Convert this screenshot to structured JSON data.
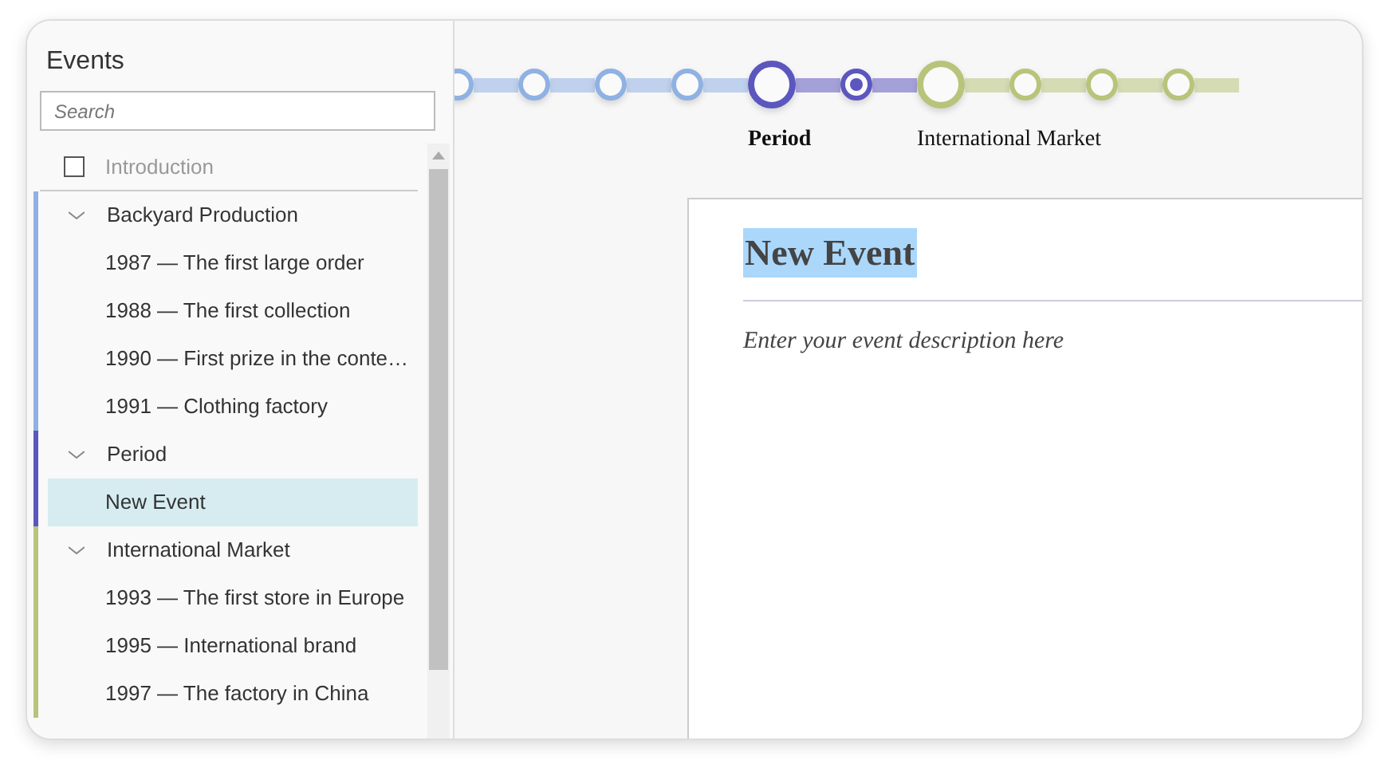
{
  "sidebar": {
    "title": "Events",
    "search": {
      "placeholder": "Search"
    },
    "intro": {
      "label": "Introduction",
      "checked": false
    },
    "groups": [
      {
        "label": "Backyard Production",
        "color": "#8fb1e3",
        "expanded": true,
        "items": [
          {
            "label": "1987 — The first large order",
            "selected": false
          },
          {
            "label": "1988 — The first collection",
            "selected": false
          },
          {
            "label": "1990 — First prize in the conte…",
            "selected": false
          },
          {
            "label": "1991 — Clothing factory",
            "selected": false
          }
        ]
      },
      {
        "label": "Period",
        "color": "#5b57bf",
        "expanded": true,
        "items": [
          {
            "label": "New Event",
            "selected": true
          }
        ]
      },
      {
        "label": "International Market",
        "color": "#b8c47a",
        "expanded": true,
        "items": [
          {
            "label": "1993 — The first store in Europe",
            "selected": false
          },
          {
            "label": "1995 — International brand",
            "selected": false
          },
          {
            "label": "1997 — The factory in China",
            "selected": false
          }
        ]
      }
    ]
  },
  "timeline": [
    {
      "color": "#8fb1e3",
      "nodes": [
        {
          "kind": "minor",
          "selected": false
        },
        {
          "kind": "minor",
          "selected": false
        },
        {
          "kind": "minor",
          "selected": false
        },
        {
          "kind": "minor",
          "selected": false
        }
      ]
    },
    {
      "label": "Period",
      "color": "#5b57bf",
      "nodes": [
        {
          "kind": "major",
          "selected": false
        },
        {
          "kind": "minor",
          "selected": true
        }
      ]
    },
    {
      "label": "International Market",
      "color": "#b8c47a",
      "nodes": [
        {
          "kind": "major",
          "selected": false
        },
        {
          "kind": "minor",
          "selected": false
        },
        {
          "kind": "minor",
          "selected": false
        },
        {
          "kind": "minor",
          "selected": false
        }
      ]
    }
  ],
  "editor": {
    "title": "New Event",
    "description": "Enter your event description here"
  }
}
